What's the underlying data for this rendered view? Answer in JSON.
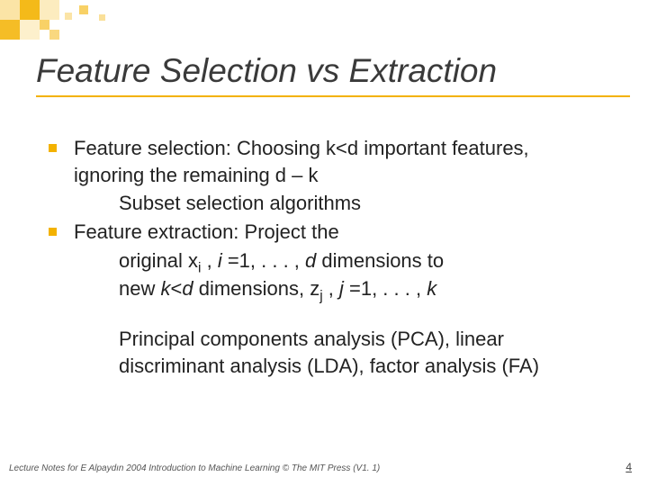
{
  "title": "Feature Selection vs Extraction",
  "items": [
    {
      "lines": [
        "Feature selection: Choosing k<d important features, ignoring the remaining d – k"
      ],
      "subs": [
        "Subset selection algorithms"
      ]
    },
    {
      "lines": [
        "Feature extraction: Project the"
      ],
      "subs": [
        "original x_i , i =1, . . . , d dimensions to",
        "new k<d dimensions, z_j , j =1, . . . , k"
      ]
    }
  ],
  "paragraph": "Principal components analysis (PCA), linear discriminant analysis (LDA), factor analysis (FA)",
  "footer": "Lecture Notes for E Alpaydın 2004 Introduction to Machine Learning © The MIT Press (V1. 1)",
  "page": "4"
}
